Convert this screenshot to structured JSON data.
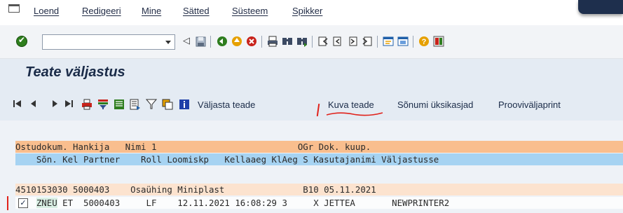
{
  "menu": {
    "items": [
      "Loend",
      "Redigeeri",
      "Mine",
      "Sätted",
      "Süsteem",
      "Spikker"
    ]
  },
  "toolbar": {
    "command_field_value": "",
    "icons": [
      "ok-icon",
      "back-icon",
      "save-icon",
      "back-arrow-icon",
      "exit-icon",
      "cancel-icon",
      "print-icon",
      "find-icon",
      "find-next-icon",
      "first-page-icon",
      "previous-page-icon",
      "next-page-icon",
      "last-page-icon",
      "create-session-icon",
      "shortcut-icon",
      "help-icon",
      "layout-icon"
    ]
  },
  "title": "Teate väljastus",
  "app_toolbar": {
    "icons": [
      "first-icon",
      "prev-icon",
      "next-icon",
      "last-icon",
      "print-list-icon",
      "filter-icon",
      "details-icon",
      "export-icon",
      "sort-icon",
      "copy-icon",
      "info-icon"
    ],
    "buttons": [
      "Väljasta teade",
      "Kuva teade",
      "Sõnumi üksikasjad",
      "Prooviväljaprint"
    ]
  },
  "list": {
    "header1": "Ostudokum. Hankija   Nimi 1                           OGr Dok. kuup.",
    "header2": "    Sõn. Kel Partner    Roll Loomiskp   Kellaaeg KlAeg S Kasutajanimi Väljastusse",
    "data1": "4510153030 5000403    Osaühing Miniplast               B10 05.11.2021",
    "data2_selected": "ZNEU",
    "data2_rest": " ET  5000403     LF    12.11.2021 16:08:29 3     X JETTEA       NEWPRINTER2",
    "data2_prefix": "    "
  },
  "colors": {
    "header1_bg": "#f9be8e",
    "header2_bg": "#a6d3f2",
    "data1_bg": "#fce3cf",
    "annotation_red": "#e0221b"
  }
}
